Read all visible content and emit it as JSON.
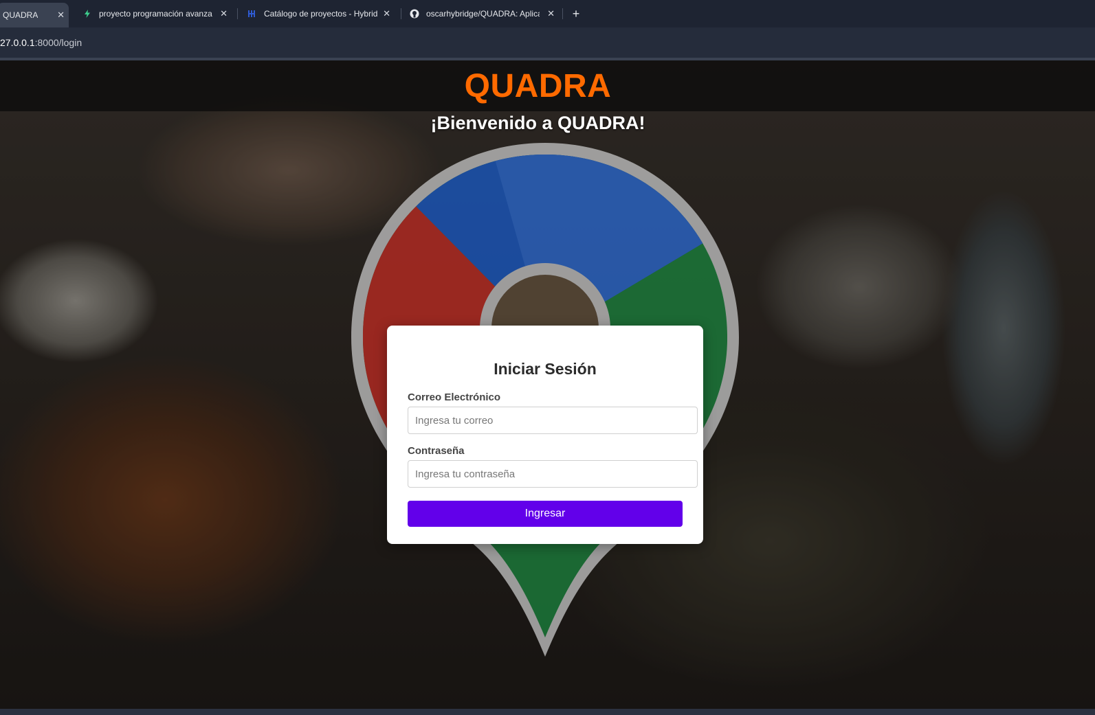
{
  "browser": {
    "tabs": [
      {
        "title": "QUADRA",
        "icon": "quadra-favicon",
        "active": true
      },
      {
        "title": "proyecto programación avanzada",
        "icon": "bolt-icon"
      },
      {
        "title": "Catálogo de proyectos - Hybridge",
        "icon": "hybridge-icon"
      },
      {
        "title": "oscarhybridge/QUADRA: Aplicación",
        "icon": "github-icon"
      }
    ],
    "new_tab": "+",
    "url_host": "27.0.0.1",
    "url_rest": ":8000/login"
  },
  "site": {
    "brand": "QUADRA",
    "welcome": "¡Bienvenido a QUADRA!",
    "brand_color": "#ff6a00"
  },
  "login": {
    "title": "Iniciar Sesión",
    "email_label": "Correo Electrónico",
    "email_placeholder": "Ingresa tu correo",
    "password_label": "Contraseña",
    "password_placeholder": "Ingresa tu contraseña",
    "submit": "Ingresar",
    "button_color": "#6200ea"
  }
}
